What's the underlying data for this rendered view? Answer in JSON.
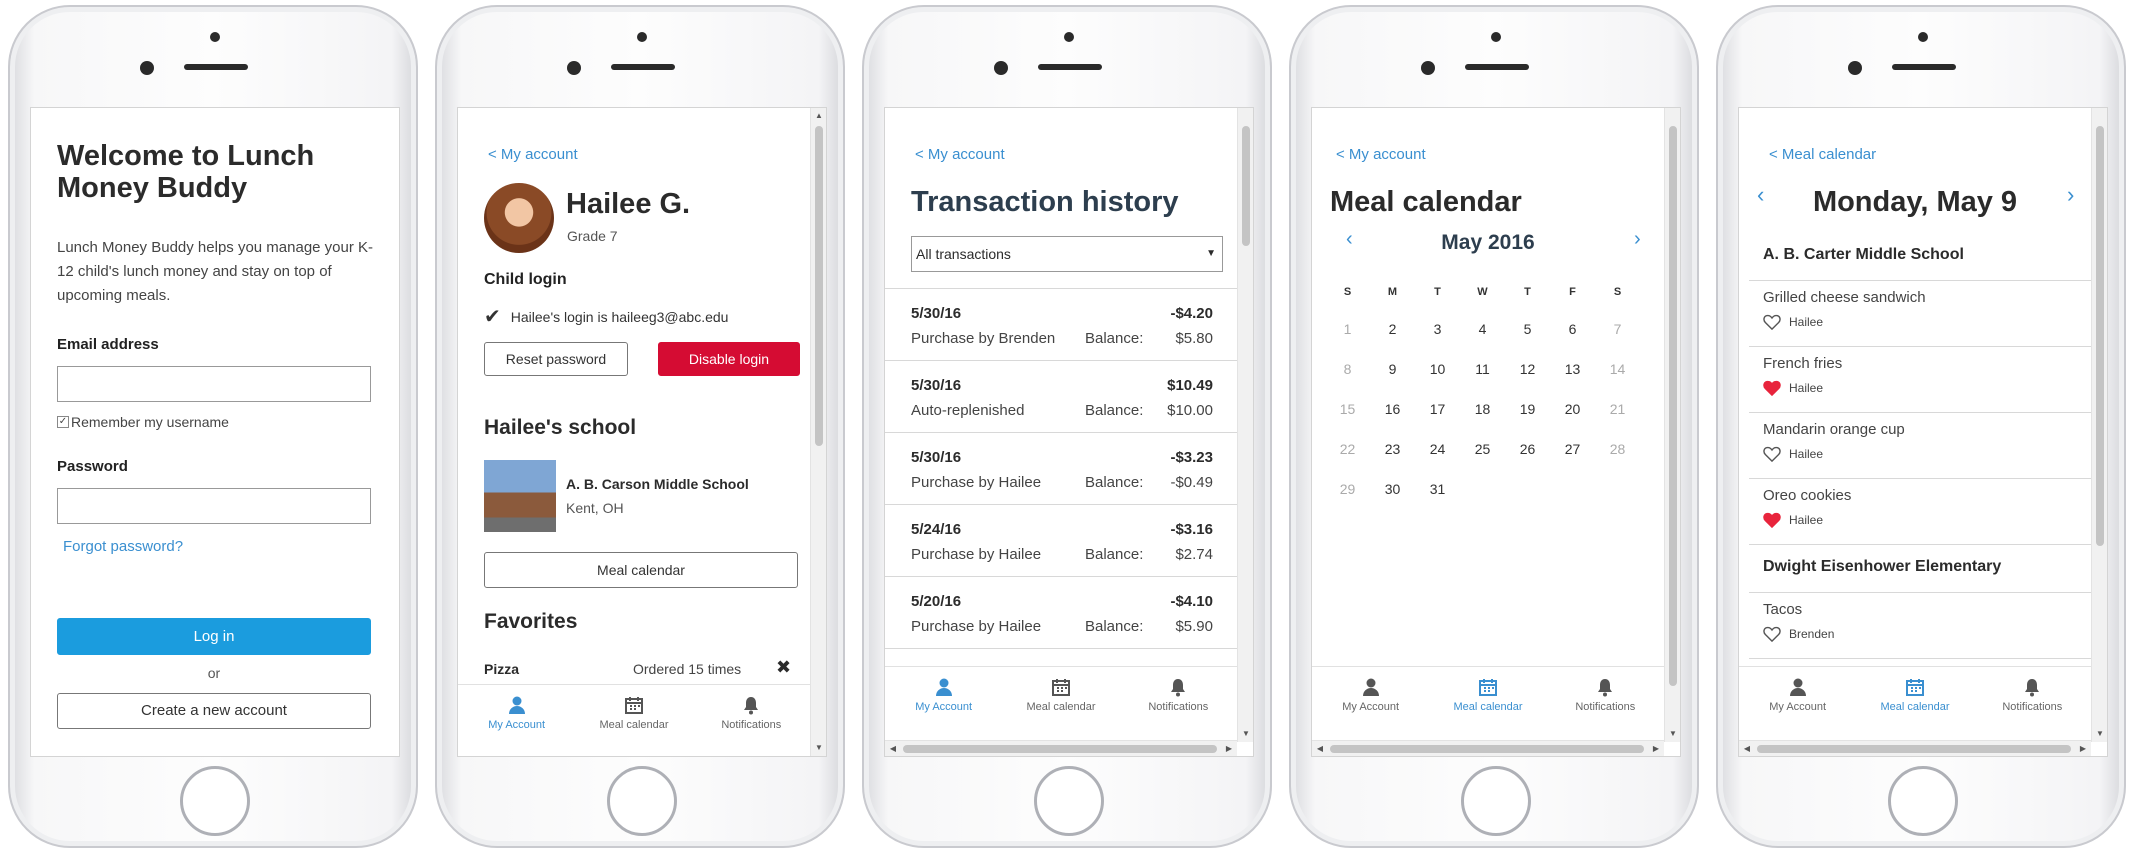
{
  "colors": {
    "accent": "#3a8fd0",
    "login_button": "#1b9cde",
    "disable_button": "#d50c33",
    "heart_filled": "#e8243c"
  },
  "screen1": {
    "title": "Welcome to Lunch Money Buddy",
    "intro": "Lunch Money Buddy helps you manage your K-12 child's lunch money and stay on top of upcoming meals.",
    "email_label": "Email address",
    "email_value": "",
    "remember_label": "Remember my username",
    "remember_checked": true,
    "password_label": "Password",
    "password_value": "",
    "forgot_link": "Forgot password?",
    "login_button": "Log in",
    "or_text": "or",
    "create_button": "Create a new account"
  },
  "screen2": {
    "back": "< My account",
    "child_name": "Hailee G.",
    "grade": "Grade 7",
    "child_login_heading": "Child login",
    "login_info": "Hailee's login is haileeg3@abc.edu",
    "reset_button": "Reset password",
    "disable_button": "Disable login",
    "school_heading": "Hailee's school",
    "school_name": "A. B. Carson Middle School",
    "school_location": "Kent, OH",
    "meal_calendar_button": "Meal calendar",
    "favorites_heading": "Favorites",
    "favorite_item": "Pizza",
    "favorite_count": "Ordered 15 times",
    "tabs": [
      {
        "label": "My Account",
        "icon": "user-icon"
      },
      {
        "label": "Meal calendar",
        "icon": "calendar-icon"
      },
      {
        "label": "Notifications",
        "icon": "bell-icon"
      }
    ]
  },
  "screen3": {
    "back": "< My account",
    "title": "Transaction history",
    "filter": "All transactions",
    "transactions": [
      {
        "date": "5/30/16",
        "amount": "-$4.20",
        "desc": "Purchase by Brenden",
        "balance_label": "Balance:",
        "balance": "$5.80"
      },
      {
        "date": "5/30/16",
        "amount": "$10.49",
        "desc": "Auto-replenished",
        "balance_label": "Balance:",
        "balance": "$10.00"
      },
      {
        "date": "5/30/16",
        "amount": "-$3.23",
        "desc": "Purchase by Hailee",
        "balance_label": "Balance:",
        "balance": "-$0.49"
      },
      {
        "date": "5/24/16",
        "amount": "-$3.16",
        "desc": "Purchase by Hailee",
        "balance_label": "Balance:",
        "balance": "$2.74"
      },
      {
        "date": "5/20/16",
        "amount": "-$4.10",
        "desc": "Purchase by Hailee",
        "balance_label": "Balance:",
        "balance": "$5.90"
      }
    ],
    "tabs": [
      {
        "label": "My Account",
        "icon": "user-icon"
      },
      {
        "label": "Meal calendar",
        "icon": "calendar-icon"
      },
      {
        "label": "Notifications",
        "icon": "bell-icon"
      }
    ]
  },
  "screen4": {
    "back": "< My account",
    "title": "Meal calendar",
    "month": "May 2016",
    "weekdays": [
      "S",
      "M",
      "T",
      "W",
      "T",
      "F",
      "S"
    ],
    "weeks": [
      [
        "1",
        "2",
        "3",
        "4",
        "5",
        "6",
        "7"
      ],
      [
        "8",
        "9",
        "10",
        "11",
        "12",
        "13",
        "14"
      ],
      [
        "15",
        "16",
        "17",
        "18",
        "19",
        "20",
        "21"
      ],
      [
        "22",
        "23",
        "24",
        "25",
        "26",
        "27",
        "28"
      ],
      [
        "29",
        "30",
        "31",
        "",
        "",
        "",
        ""
      ]
    ],
    "tabs": [
      {
        "label": "My Account",
        "icon": "user-icon"
      },
      {
        "label": "Meal calendar",
        "icon": "calendar-icon"
      },
      {
        "label": "Notifications",
        "icon": "bell-icon"
      }
    ]
  },
  "screen5": {
    "back": "< Meal calendar",
    "day_title": "Monday, May 9",
    "school1": "A. B. Carter Middle School",
    "items1": [
      {
        "name": "Grilled cheese sandwich",
        "who": "Hailee",
        "favorite": false
      },
      {
        "name": "French fries",
        "who": "Hailee",
        "favorite": true
      },
      {
        "name": "Mandarin orange cup",
        "who": "Hailee",
        "favorite": false
      },
      {
        "name": "Oreo cookies",
        "who": "Hailee",
        "favorite": true
      }
    ],
    "school2": "Dwight Eisenhower Elementary",
    "items2": [
      {
        "name": "Tacos",
        "who": "Brenden",
        "favorite": false
      }
    ],
    "tabs": [
      {
        "label": "My Account",
        "icon": "user-icon"
      },
      {
        "label": "Meal calendar",
        "icon": "calendar-icon"
      },
      {
        "label": "Notifications",
        "icon": "bell-icon"
      }
    ]
  }
}
